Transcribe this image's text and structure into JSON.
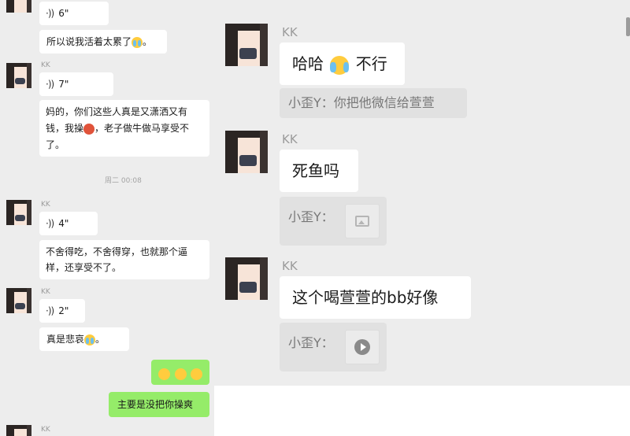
{
  "left": {
    "msg_top_voice": "6\"",
    "msg_tired": "所以说我活着太累了",
    "msg_tired_end": "。",
    "kk1": "KK",
    "voice1": "7\"",
    "msg_long_1": "妈的，你们这些人真是又潇洒又有",
    "msg_long_2": "钱，我操",
    "msg_long_3": "，老子做牛做马享受不",
    "msg_long_4": "了。",
    "time": "周二 00:08",
    "kk2": "KK",
    "voice2": "4\"",
    "msg_eat_1": "不舍得吃，不舍得穿，也就那个逼",
    "msg_eat_2": "样，还享受不了。",
    "kk3": "KK",
    "voice3": "2\"",
    "msg_sad": "真是悲哀",
    "msg_sad_end": "。",
    "self_msg": "主要是没把你操爽",
    "kk4": "KK"
  },
  "right": {
    "kk1": "KK",
    "msg_haha": "哈哈",
    "msg_no": "不行",
    "quote1": "小歪Y：你把他微信给萱萱",
    "kk2": "KK",
    "msg_deadfish": "死鱼吗",
    "quote2": "小歪Y：",
    "kk3": "KK",
    "msg_bb": "这个喝萱萱的bb好像",
    "quote3": "小歪Y："
  },
  "colors": {
    "background": "#ededed",
    "bubble_in": "#ffffff",
    "bubble_out": "#95ec69",
    "quote_bg": "#e1e1e1"
  }
}
